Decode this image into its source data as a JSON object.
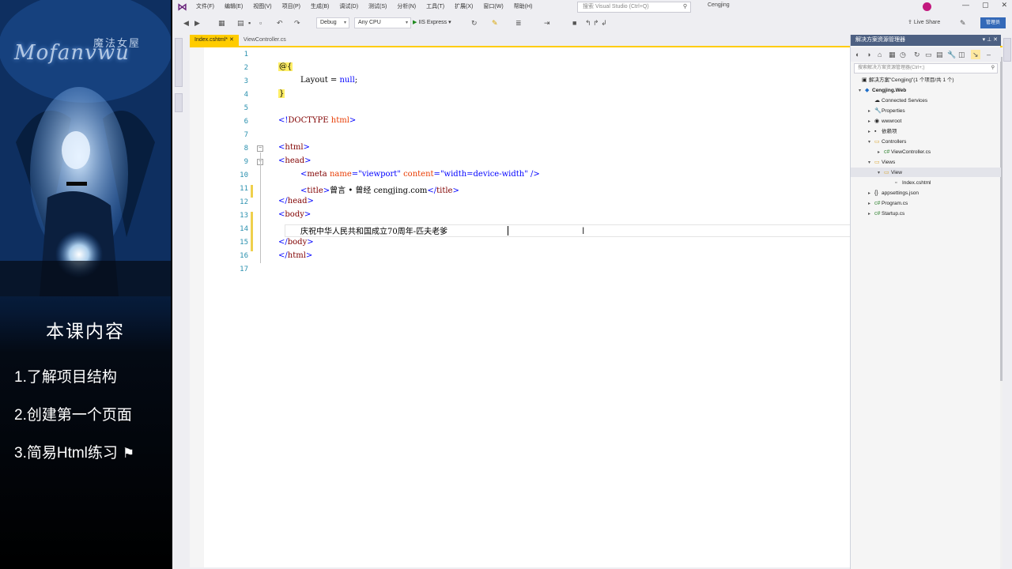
{
  "course": {
    "logo_text": "Mofanvwu",
    "logo_cn": "魔法女屋",
    "title": "本课内容",
    "items": [
      "1.了解项目结构",
      "2.创建第一个页面",
      "3.简易Html练习"
    ]
  },
  "vs": {
    "menus": [
      "文件(F)",
      "编辑(E)",
      "视图(V)",
      "项目(P)",
      "生成(B)",
      "调试(D)",
      "测试(S)",
      "分析(N)",
      "工具(T)",
      "扩展(X)",
      "窗口(W)",
      "帮助(H)"
    ],
    "search_placeholder": "搜索 Visual Studio (Ctrl+Q)",
    "solution_name": "Cengjing",
    "config": "Debug",
    "platform": "Any CPU",
    "run_label": "IIS Express",
    "live_share": "Live Share",
    "feedback": "管理员",
    "tabs": [
      "Index.cshtml*",
      "ViewController.cs"
    ]
  },
  "editor": {
    "line_numbers": [
      "1",
      "2",
      "3",
      "4",
      "5",
      "6",
      "7",
      "8",
      "9",
      "10",
      "11",
      "12",
      "13",
      "14",
      "15",
      "16",
      "17"
    ],
    "code": {
      "l2": "@{",
      "l3_a": "Layout",
      "l3_b": " = ",
      "l3_c": "null",
      "l3_d": ";",
      "l4": "}",
      "l6_a": "<!",
      "l6_b": "DOCTYPE",
      "l6_c": " html",
      "l6_d": ">",
      "l8_a": "<",
      "l8_b": "html",
      "l8_c": ">",
      "l9_a": "<",
      "l9_b": "head",
      "l9_c": ">",
      "l10_a": "<",
      "l10_b": "meta",
      "l10_c": " name",
      "l10_d": "=",
      "l10_e": "\"viewport\"",
      "l10_f": " content",
      "l10_g": "=",
      "l10_h": "\"width=device-width\"",
      "l10_i": " />",
      "l11_a": "<",
      "l11_b": "title",
      "l11_c": ">",
      "l11_d": "曾言 • 曾经 cengjing.com",
      "l11_e": "</",
      "l11_f": "title",
      "l11_g": ">",
      "l12_a": "</",
      "l12_b": "head",
      "l12_c": ">",
      "l13_a": "<",
      "l13_b": "body",
      "l13_c": ">",
      "l14": "庆祝中华人民共和国成立70周年-匹夫老爹",
      "l15_a": "</",
      "l15_b": "body",
      "l15_c": ">",
      "l16_a": "</",
      "l16_b": "html",
      "l16_c": ">"
    }
  },
  "solution_explorer": {
    "title": "解决方案资源管理器",
    "search_placeholder": "搜索解决方案资源管理器(Ctrl+;)",
    "items": [
      {
        "label": "解决方案\"Cengjing\"(1 个项目/共 1 个)",
        "exp": "",
        "icon": "▣"
      },
      {
        "label": "Cengjing.Web",
        "exp": "▾",
        "icon": "◆"
      },
      {
        "label": "Connected Services",
        "exp": "",
        "icon": "☁"
      },
      {
        "label": "Properties",
        "exp": "▸",
        "icon": "🔧"
      },
      {
        "label": "wwwroot",
        "exp": "▸",
        "icon": "◉"
      },
      {
        "label": "依赖项",
        "exp": "▸",
        "icon": "▪"
      },
      {
        "label": "Controllers",
        "exp": "▾",
        "icon": "▭"
      },
      {
        "label": "ViewController.cs",
        "exp": "▸",
        "icon": "c#"
      },
      {
        "label": "Views",
        "exp": "▾",
        "icon": "▭"
      },
      {
        "label": "View",
        "exp": "▾",
        "icon": "▭"
      },
      {
        "label": "Index.cshtml",
        "exp": "",
        "icon": "▫"
      },
      {
        "label": "appsettings.json",
        "exp": "▸",
        "icon": "{}"
      },
      {
        "label": "Program.cs",
        "exp": "▸",
        "icon": "c#"
      },
      {
        "label": "Startup.cs",
        "exp": "▸",
        "icon": "c#"
      }
    ]
  }
}
